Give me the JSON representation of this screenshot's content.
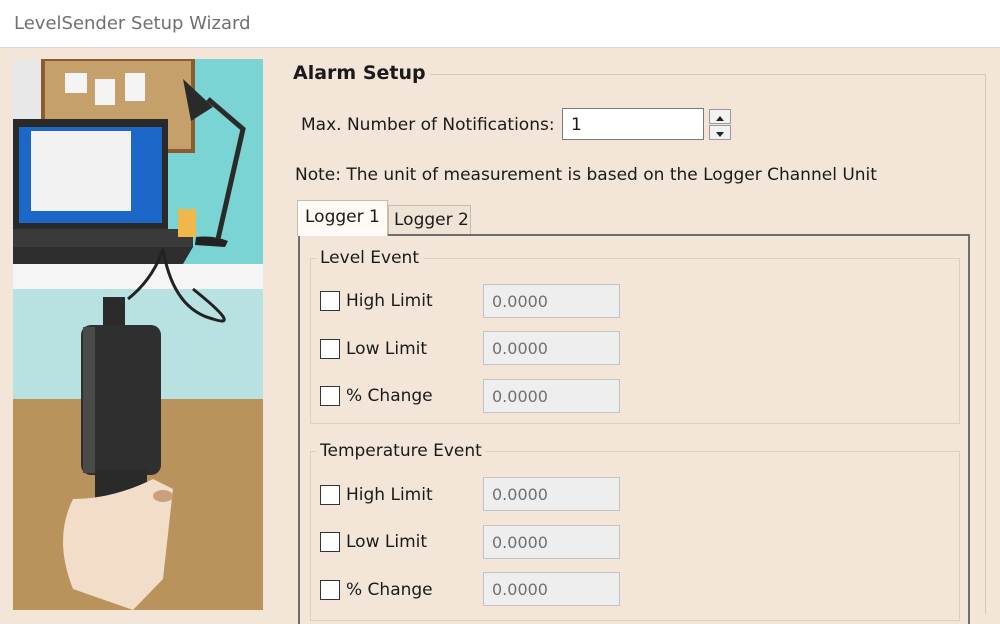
{
  "window": {
    "title": "LevelSender Setup Wizard"
  },
  "alarm_setup": {
    "group_title": "Alarm Setup",
    "max_notifications_label": "Max. Number of Notifications:",
    "max_notifications_value": "1",
    "note": "Note: The unit of measurement is based on the Logger Channel Unit"
  },
  "tabs": [
    {
      "label": "Logger 1",
      "selected": true
    },
    {
      "label": "Logger 2",
      "selected": false
    }
  ],
  "level_event": {
    "legend": "Level Event",
    "rows": [
      {
        "label": "High Limit",
        "checked": false,
        "value": "0.0000"
      },
      {
        "label": "Low Limit",
        "checked": false,
        "value": "0.0000"
      },
      {
        "label": "% Change",
        "checked": false,
        "value": "0.0000"
      }
    ]
  },
  "temperature_event": {
    "legend": "Temperature Event",
    "rows": [
      {
        "label": "High Limit",
        "checked": false,
        "value": "0.0000"
      },
      {
        "label": "Low Limit",
        "checked": false,
        "value": "0.0000"
      },
      {
        "label": "% Change",
        "checked": false,
        "value": "0.0000"
      }
    ]
  }
}
